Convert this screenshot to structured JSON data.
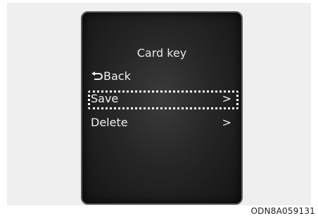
{
  "screen": {
    "title": "Card key",
    "menu": {
      "back": {
        "label": "Back",
        "icon": "back-arrow-icon"
      },
      "items": [
        {
          "label": "Save",
          "chevron": ">",
          "focused": true
        },
        {
          "label": "Delete",
          "chevron": ">"
        }
      ]
    }
  },
  "caption": "ODN8A059131"
}
